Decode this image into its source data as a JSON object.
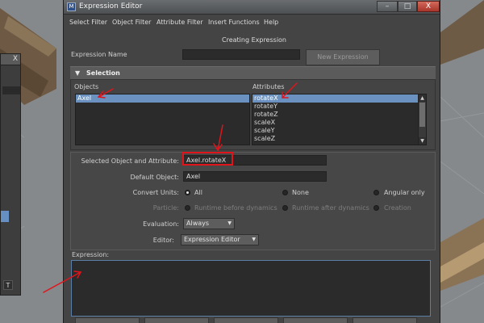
{
  "window": {
    "title": "Expression Editor",
    "icon_name": "expression-editor-icon",
    "controls": {
      "minimize": "–",
      "maximize": "□",
      "close": "X"
    }
  },
  "menu": [
    "Select Filter",
    "Object Filter",
    "Attribute Filter",
    "Insert Functions",
    "Help"
  ],
  "header": {
    "mode_label": "Creating Expression",
    "expression_name_label": "Expression Name",
    "expression_name_value": "",
    "new_expression_button": "New Expression"
  },
  "selection": {
    "title": "Selection",
    "objects_label": "Objects",
    "attributes_label": "Attributes",
    "objects": [
      "Axel"
    ],
    "selected_object": "Axel",
    "attributes": [
      "rotateX",
      "rotateY",
      "rotateZ",
      "scaleX",
      "scaleY",
      "scaleZ"
    ],
    "selected_attribute": "rotateX"
  },
  "details": {
    "selected_object_attribute_label": "Selected Object and Attribute:",
    "selected_object_attribute_value": "Axel.rotateX",
    "default_object_label": "Default Object:",
    "default_object_value": "Axel",
    "convert_units_label": "Convert Units:",
    "convert_units_options": [
      "All",
      "None",
      "Angular only"
    ],
    "convert_units_selected": "All",
    "particle_label": "Particle:",
    "particle_options": [
      "Runtime before dynamics",
      "Runtime after dynamics",
      "Creation"
    ],
    "evaluation_label": "Evaluation:",
    "evaluation_value": "Always",
    "editor_label": "Editor:",
    "editor_value": "Expression Editor"
  },
  "expression": {
    "label": "Expression:",
    "value": ""
  },
  "background": {
    "badge_text": "T",
    "panel_close": "X"
  },
  "colors": {
    "window_bg": "#444444",
    "selection_highlight": "#6a91bf",
    "annotation_red": "#e0141b"
  }
}
